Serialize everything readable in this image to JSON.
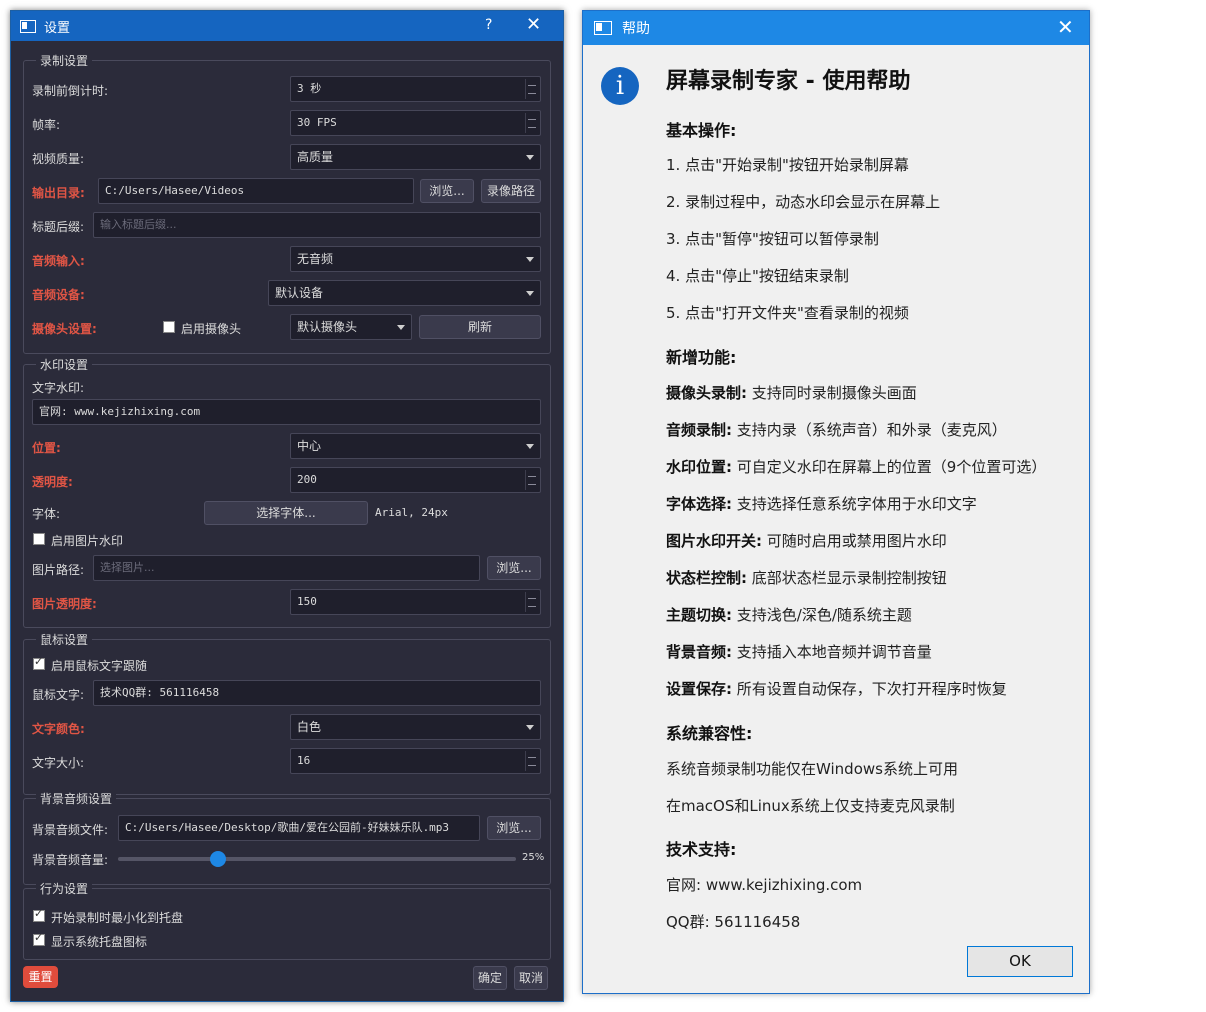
{
  "settings": {
    "title": "设置",
    "help_btn": "?",
    "close_btn": "✕",
    "recording": {
      "group_title": "录制设置",
      "countdown_label": "录制前倒计时:",
      "countdown_value": "3 秒",
      "fps_label": "帧率:",
      "fps_value": "30 FPS",
      "quality_label": "视频质量:",
      "quality_value": "高质量",
      "output_label": "输出目录:",
      "output_value": "C:/Users/Hasee/Videos",
      "browse_label": "浏览...",
      "record_path_label": "录像路径",
      "suffix_label": "标题后缀:",
      "suffix_placeholder": "输入标题后缀...",
      "audio_input_label": "音频输入:",
      "audio_input_value": "无音频",
      "audio_device_label": "音频设备:",
      "audio_device_value": "默认设备",
      "camera_label": "摄像头设置:",
      "camera_enable_label": "启用摄像头",
      "camera_value": "默认摄像头",
      "refresh_label": "刷新"
    },
    "watermark": {
      "group_title": "水印设置",
      "text_label": "文字水印:",
      "text_value": "官网: www.kejizhixing.com",
      "position_label": "位置:",
      "position_value": "中心",
      "opacity_label": "透明度:",
      "opacity_value": "200",
      "font_label": "字体:",
      "font_button": "选择字体...",
      "font_info": "Arial, 24px",
      "image_enable_label": "启用图片水印",
      "image_path_label": "图片路径:",
      "image_path_placeholder": "选择图片...",
      "image_browse": "浏览...",
      "image_opacity_label": "图片透明度:",
      "image_opacity_value": "150"
    },
    "mouse": {
      "group_title": "鼠标设置",
      "follow_label": "启用鼠标文字跟随",
      "text_label": "鼠标文字:",
      "text_value": "技术QQ群: 561116458",
      "color_label": "文字颜色:",
      "color_value": "白色",
      "size_label": "文字大小:",
      "size_value": "16"
    },
    "bgm": {
      "group_title": "背景音频设置",
      "file_label": "背景音频文件:",
      "file_value": "C:/Users/Hasee/Desktop/歌曲/爱在公园前-好妹妹乐队.mp3",
      "browse": "浏览...",
      "volume_label": "背景音频音量:",
      "volume_text": "25%",
      "volume_fraction": 0.25
    },
    "behavior": {
      "group_title": "行为设置",
      "minimize_label": "开始录制时最小化到托盘",
      "tray_label": "显示系统托盘图标"
    },
    "reset_label": "重置",
    "ok_label": "确定",
    "cancel_label": "取消"
  },
  "help": {
    "title": "帮助",
    "close_btn": "✕",
    "heading": "屏幕录制专家 - 使用帮助",
    "basic_title": "基本操作:",
    "basic_items": [
      "1. 点击\"开始录制\"按钮开始录制屏幕",
      "2. 录制过程中，动态水印会显示在屏幕上",
      "3. 点击\"暂停\"按钮可以暂停录制",
      "4. 点击\"停止\"按钮结束录制",
      "5. 点击\"打开文件夹\"查看录制的视频"
    ],
    "new_title": "新增功能:",
    "features": [
      {
        "name": "摄像头录制:",
        "desc": " 支持同时录制摄像头画面"
      },
      {
        "name": "音频录制:",
        "desc": " 支持内录（系统声音）和外录（麦克风）"
      },
      {
        "name": "水印位置:",
        "desc": " 可自定义水印在屏幕上的位置（9个位置可选）"
      },
      {
        "name": "字体选择:",
        "desc": " 支持选择任意系统字体用于水印文字"
      },
      {
        "name": "图片水印开关:",
        "desc": " 可随时启用或禁用图片水印"
      },
      {
        "name": "状态栏控制:",
        "desc": " 底部状态栏显示录制控制按钮"
      },
      {
        "name": "主题切换:",
        "desc": " 支持浅色/深色/随系统主题"
      },
      {
        "name": "背景音频:",
        "desc": " 支持插入本地音频并调节音量"
      },
      {
        "name": "设置保存:",
        "desc": " 所有设置自动保存，下次打开程序时恢复"
      }
    ],
    "compat_title": "系统兼容性:",
    "compat_items": [
      "系统音频录制功能仅在Windows系统上可用",
      "在macOS和Linux系统上仅支持麦克风录制"
    ],
    "support_title": "技术支持:",
    "website": "官网: www.kejizhixing.com",
    "qq": "QQ群: 561116458",
    "ok_label": "OK"
  },
  "colors": {
    "titlebar_left": "#1565c0",
    "titlebar_right": "#1e88e5",
    "dark_bg": "#2b2b3a",
    "required_label": "#e05545",
    "reset_button": "#e04c3c"
  }
}
